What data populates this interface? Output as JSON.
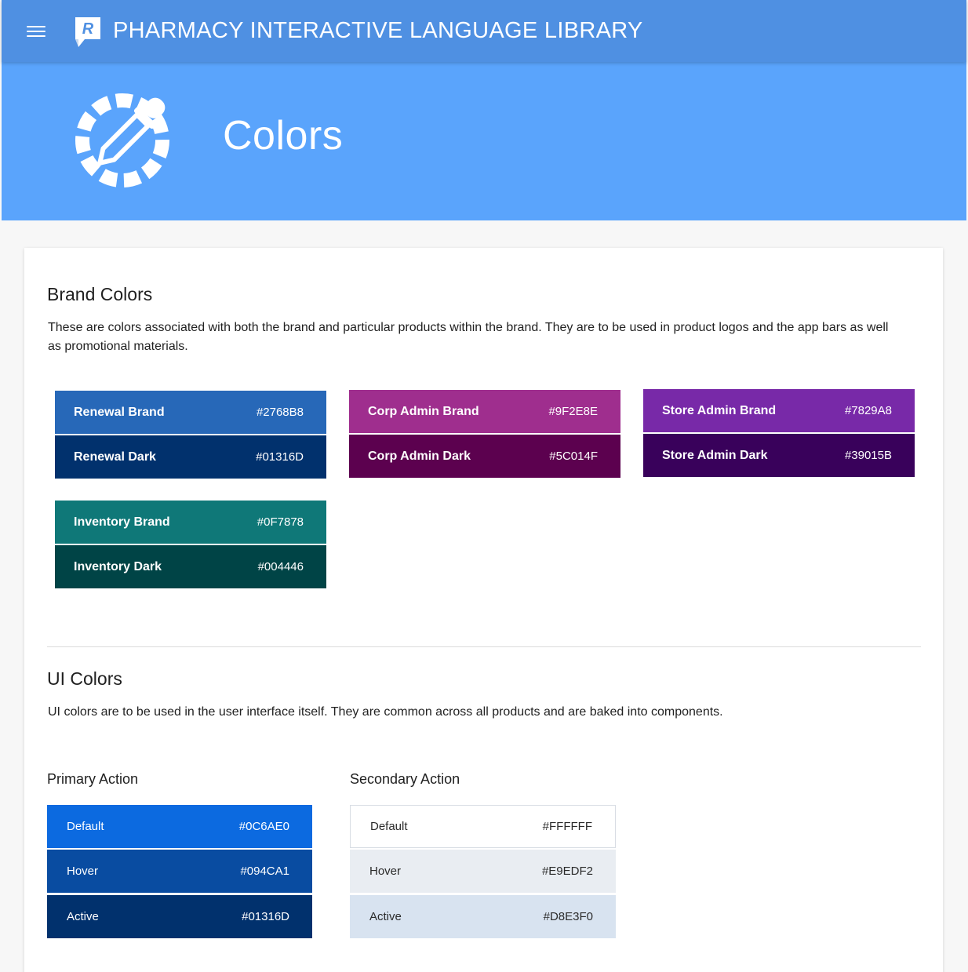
{
  "appbar": {
    "title": "PHARMACY INTERACTIVE LANGUAGE LIBRARY",
    "logo_letter": "R",
    "menu_icon": "menu-icon"
  },
  "hero": {
    "title": "Colors",
    "icon": "eyedropper-icon"
  },
  "brand": {
    "title": "Brand Colors",
    "description": "These are colors associated with both the brand and particular products within the brand. They are to be used in product logos and the app bars as well as promotional materials.",
    "swatches": [
      {
        "label": "Renewal Brand",
        "hex": "#2768B8",
        "color": "#2768B8"
      },
      {
        "label": "Renewal Dark",
        "hex": "#01316D",
        "color": "#01316D"
      },
      {
        "label": "Corp Admin Brand",
        "hex": "#9F2E8E",
        "color": "#9F2E8E"
      },
      {
        "label": "Corp Admin Dark",
        "hex": "#5C014F",
        "color": "#5C014F"
      },
      {
        "label": "Store Admin Brand",
        "hex": "#7829A8",
        "color": "#7829A8"
      },
      {
        "label": "Store Admin Dark",
        "hex": "#39015B",
        "color": "#39015B"
      },
      {
        "label": "Inventory Brand",
        "hex": "#0F7878",
        "color": "#0F7878"
      },
      {
        "label": "Inventory Dark",
        "hex": "#004446",
        "color": "#004446"
      }
    ]
  },
  "ui": {
    "title": "UI Colors",
    "description": "UI colors are to be used in the user interface itself. They are common across all products and are baked into components.",
    "primary": {
      "title": "Primary Action",
      "swatches": [
        {
          "label": "Default",
          "hex": "#0C6AE0",
          "color": "#0C6AE0"
        },
        {
          "label": "Hover",
          "hex": "#094CA1",
          "color": "#094CA1"
        },
        {
          "label": "Active",
          "hex": "#01316D",
          "color": "#01316D"
        }
      ]
    },
    "secondary": {
      "title": "Secondary Action",
      "swatches": [
        {
          "label": "Default",
          "hex": "#FFFFFF",
          "color": "#FFFFFF"
        },
        {
          "label": "Hover",
          "hex": "#E9EDF2",
          "color": "#E9EDF2"
        },
        {
          "label": "Active",
          "hex": "#D8E3F0",
          "color": "#D8E3F0"
        }
      ]
    }
  }
}
